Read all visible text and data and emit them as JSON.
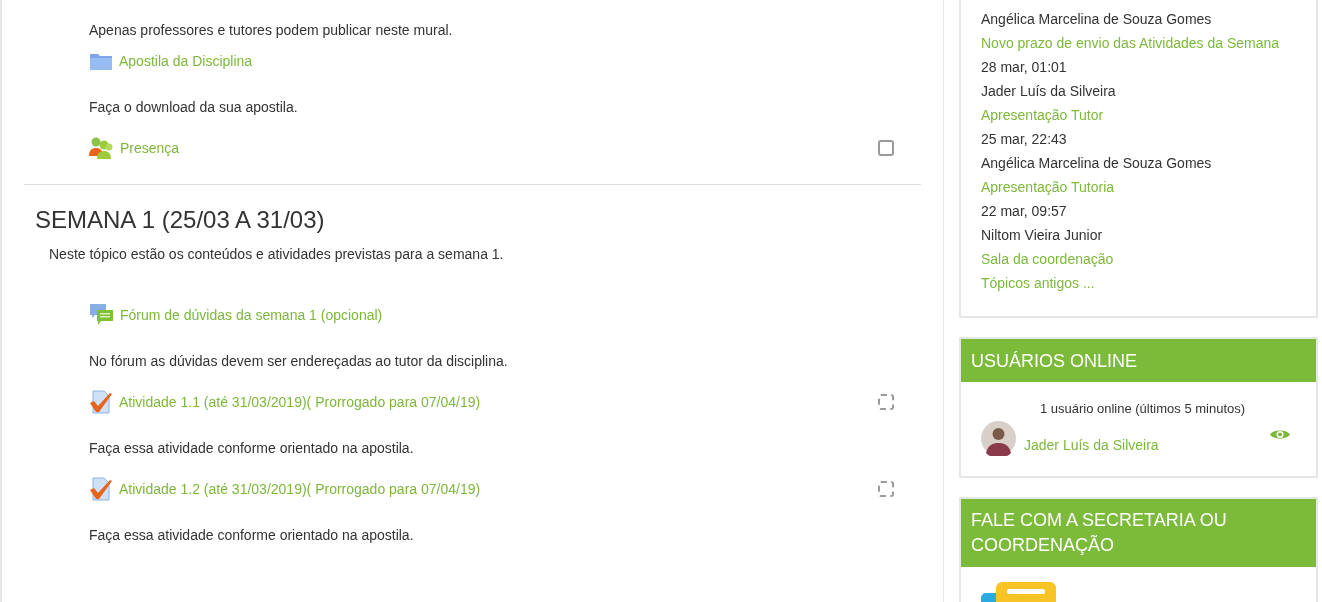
{
  "sections": [
    {
      "items": [
        {
          "kind": "text",
          "text": "Apenas professores e tutores podem publicar neste mural."
        },
        {
          "kind": "folder",
          "label": "Apostila da Disciplina",
          "description": "Faça o download da sua apostila."
        },
        {
          "kind": "attendance",
          "label": "Presença",
          "completion": {
            "kind": "manual",
            "checked": false
          }
        }
      ]
    },
    {
      "title": "SEMANA 1 (25/03 A 31/03)",
      "summary": "Neste tópico estão os conteúdos e atividades previstas para a semana 1.",
      "items": [
        {
          "kind": "forum",
          "label": "Fórum de dúvidas da semana 1 (opcional)",
          "description": "No fórum as dúvidas devem ser endereçadas ao tutor da disciplina."
        },
        {
          "kind": "assignment",
          "label": "Atividade 1.1 (até 31/03/2019)( Prorrogado para 07/04/19)",
          "description": "Faça essa atividade conforme orientado na apostila.",
          "completion": {
            "kind": "auto",
            "checked": false
          }
        },
        {
          "kind": "assignment",
          "label": "Atividade 1.2 (até 31/03/2019)( Prorrogado para 07/04/19)",
          "description": "Faça essa atividade conforme orientado na apostila.",
          "completion": {
            "kind": "auto",
            "checked": false
          }
        }
      ]
    }
  ],
  "sidebar": {
    "recent_posts": [
      {
        "kind": "author",
        "text": "Angélica Marcelina de Souza Gomes"
      },
      {
        "kind": "link",
        "text": "Novo prazo de envio das Atividades da Semana"
      },
      {
        "kind": "date",
        "text": "28 mar, 01:01"
      },
      {
        "kind": "author",
        "text": "Jader Luís da Silveira"
      },
      {
        "kind": "link",
        "text": "Apresentação Tutor"
      },
      {
        "kind": "date",
        "text": "25 mar, 22:43"
      },
      {
        "kind": "author",
        "text": "Angélica Marcelina de Souza Gomes"
      },
      {
        "kind": "link",
        "text": "Apresentação Tutoria"
      },
      {
        "kind": "date",
        "text": "22 mar, 09:57"
      },
      {
        "kind": "author",
        "text": "Niltom Vieira Junior"
      },
      {
        "kind": "link",
        "text": "Sala da coordenação"
      },
      {
        "kind": "link",
        "text": "Tópicos antigos ..."
      }
    ],
    "online_users": {
      "title": "USUÁRIOS ONLINE",
      "summary": "1 usuário online (últimos 5 minutos)",
      "users": [
        {
          "name": "Jader Luís da Silveira"
        }
      ]
    },
    "contact": {
      "title": "FALE COM A SECRETARIA OU COORDENAÇÃO"
    }
  }
}
